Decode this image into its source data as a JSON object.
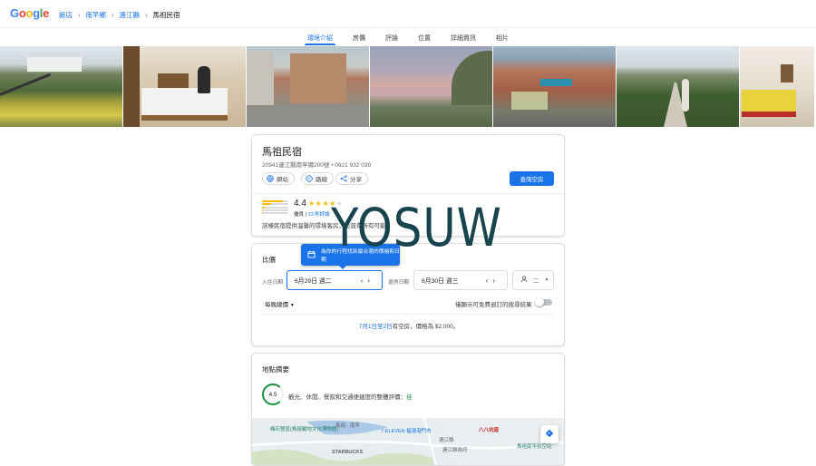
{
  "header": {
    "logo_text": "Google",
    "breadcrumbs": [
      "飯店",
      "南竿鄉",
      "連江縣",
      "馬祖民宿"
    ]
  },
  "tabs": [
    "環境介紹",
    "房價",
    "評論",
    "位置",
    "詳細資訊",
    "相片"
  ],
  "active_tab": "環境介紹",
  "hotel": {
    "name": "馬祖民宿",
    "address": "20941連江縣南竿鄉200號 • 0921 932 039",
    "actions": {
      "website": "網站",
      "directions": "路線",
      "share": "分享"
    },
    "check_availability": "查詢空房",
    "rating": "4.4",
    "rating_label": "優良",
    "reviews_link": "33 則評論",
    "rating_distribution": [
      0.8,
      0.35,
      0.12,
      0.05,
      0.05
    ],
    "description": "該棟民宿提供溫馨的環境客房，並設有所有可能"
  },
  "watermark": "YOSUW",
  "pricing": {
    "title": "比價",
    "tooltip": "為你的行程找到最合適的價格和日期",
    "check_in_label": "入住日期",
    "check_in_value": "6月29日 週二",
    "check_out_label": "退房日期",
    "check_out_value": "6月30日 週三",
    "guests_value": "二",
    "nightly_label": "每晚總價",
    "toggle_label": "僅顯示可免費退訂的搜尋結果",
    "availability_dates": "7月1日至2日",
    "availability_rest": "有空房，價格為 $2,000。"
  },
  "location": {
    "title": "地點摘要",
    "score": "4.5",
    "score_text": "觀光、休閒、餐飲和交通便捷度的整體評價：",
    "score_word": "佳",
    "map_labels": {
      "museum": "梅石營區(馬祖戰地文化博物館)",
      "lake": "馬祖 - 南竿",
      "store": "7-ELEVEN 福澳港門市",
      "restaurant": "八八坑道",
      "office": "連江縣",
      "gov": "連江縣政府",
      "airport": "馬祖南竿航空站",
      "starbucks": "STARBUCKS"
    }
  },
  "colors": {
    "accent": "#1a73e8",
    "star": "#fbbc04",
    "good": "#1e8e3e"
  }
}
